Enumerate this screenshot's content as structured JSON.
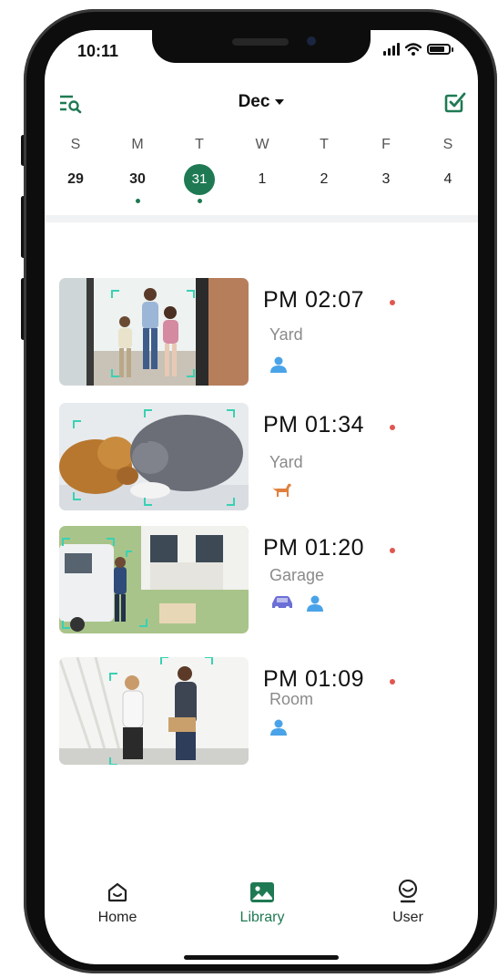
{
  "status": {
    "time": "10:11"
  },
  "header": {
    "month": "Dec",
    "filter_icon": "list-search-icon",
    "select_icon": "checkbox-edit-icon"
  },
  "week": {
    "days": [
      {
        "name": "S",
        "num": "29",
        "selected": false,
        "has_events": false
      },
      {
        "name": "M",
        "num": "30",
        "selected": false,
        "has_events": true
      },
      {
        "name": "T",
        "num": "31",
        "selected": true,
        "has_events": true
      },
      {
        "name": "W",
        "num": "1",
        "selected": false,
        "has_events": false
      },
      {
        "name": "T",
        "num": "2",
        "selected": false,
        "has_events": false
      },
      {
        "name": "F",
        "num": "3",
        "selected": false,
        "has_events": false
      },
      {
        "name": "S",
        "num": "4",
        "selected": false,
        "has_events": false
      }
    ]
  },
  "events": [
    {
      "time": "PM  02:07",
      "location": "Yard",
      "icons": [
        "person-icon"
      ]
    },
    {
      "time": "PM  01:34",
      "location": "Yard",
      "icons": [
        "dog-icon"
      ]
    },
    {
      "time": "PM  01:20",
      "location": "Garage",
      "icons": [
        "car-icon",
        "person-icon"
      ]
    },
    {
      "time": "PM  01:09",
      "location": "Room",
      "icons": [
        "person-icon"
      ]
    }
  ],
  "tabs": [
    {
      "label": "Home",
      "icon": "home-icon"
    },
    {
      "label": "Library",
      "icon": "gallery-icon",
      "active": true
    },
    {
      "label": "User",
      "icon": "user-avatar-icon"
    }
  ],
  "colors": {
    "accent": "#1f7a53",
    "unread_dot": "#e0564f",
    "person_icon": "#4aa3e8",
    "dog_icon": "#e0803d",
    "car_icon": "#6b6fd6"
  }
}
